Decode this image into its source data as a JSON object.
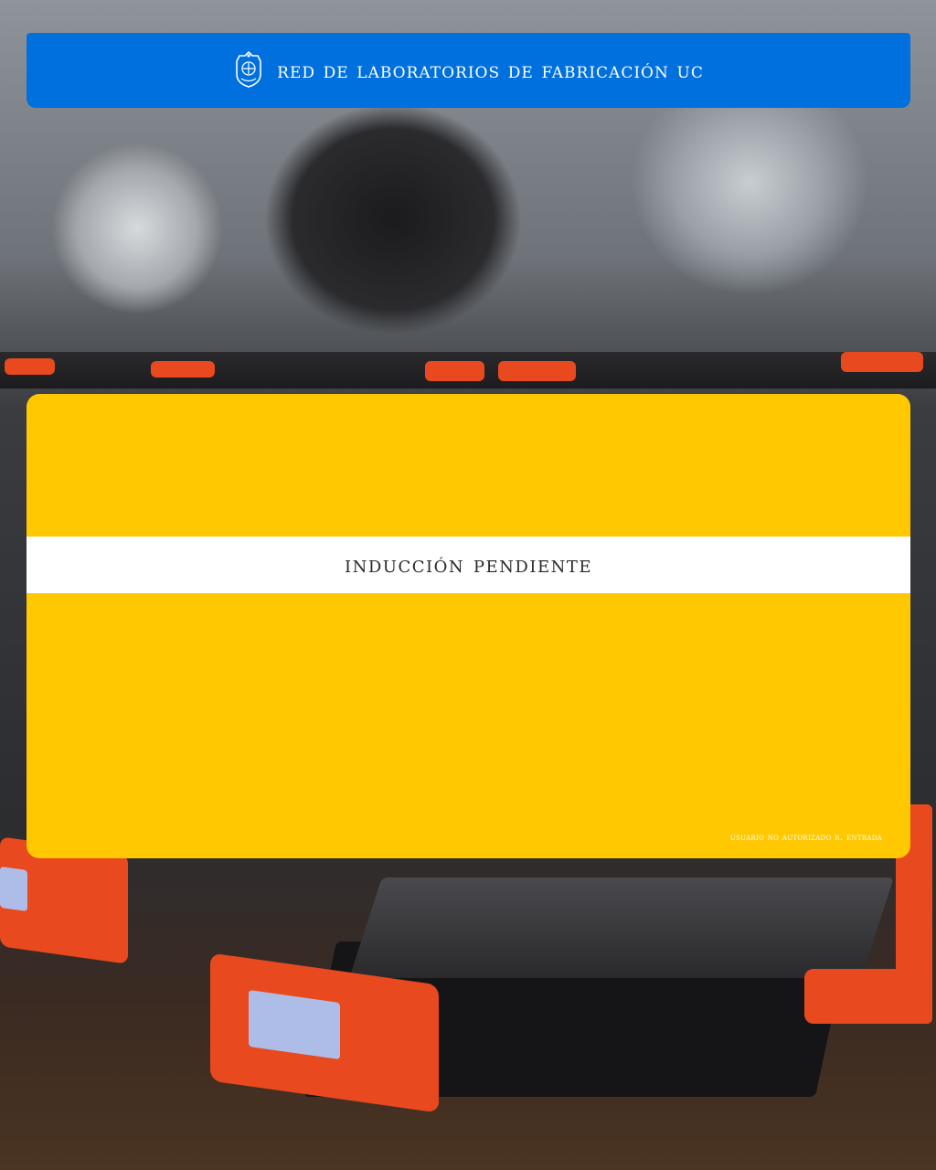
{
  "header": {
    "title": "RED DE LABORATORIOS DE FABRICACIÓN UC",
    "logo_icon": "uc-crest-icon",
    "background_color": "#0070de"
  },
  "status_card": {
    "status": "INDUCCIÓN PENDIENTE",
    "message": "USUARIO NO AUTORIZADO R. ENTRADA",
    "background_color": "#ffc800",
    "band_color": "#ffffff"
  }
}
